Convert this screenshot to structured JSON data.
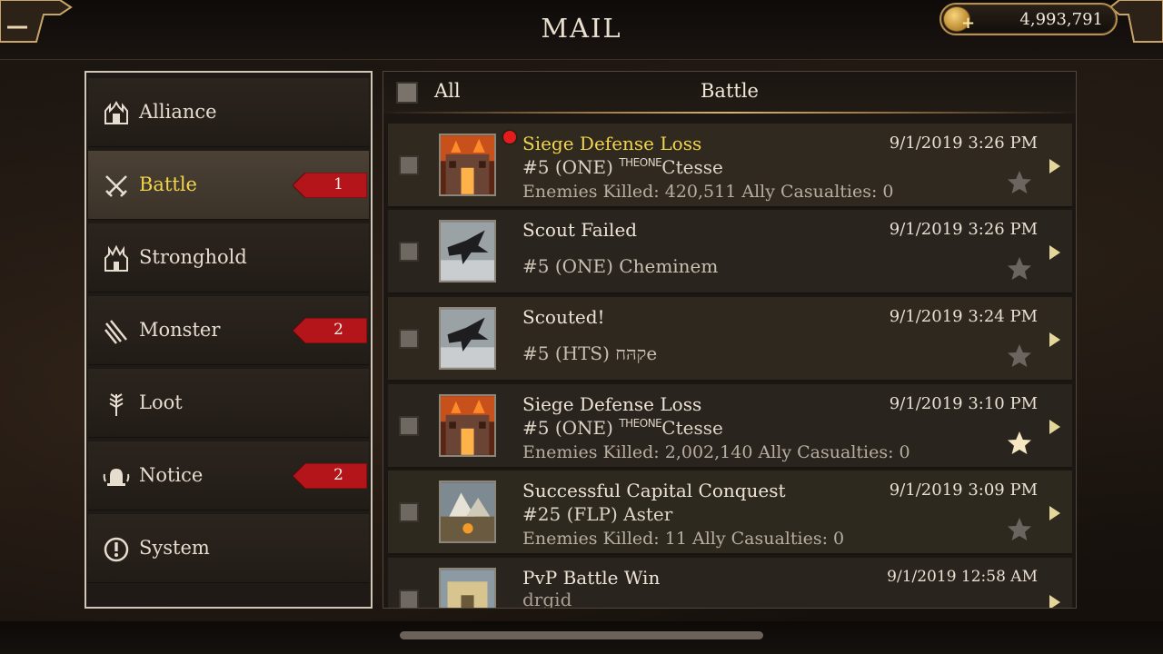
{
  "header": {
    "title": "MAIL",
    "gold": "4,993,791"
  },
  "sidebar": {
    "items": [
      {
        "label": "Alliance",
        "icon": "alliance-icon",
        "badge": ""
      },
      {
        "label": "Battle",
        "icon": "crossed-swords-icon",
        "badge": "1",
        "active": true
      },
      {
        "label": "Stronghold",
        "icon": "stronghold-icon",
        "badge": ""
      },
      {
        "label": "Monster",
        "icon": "claw-icon",
        "badge": "2"
      },
      {
        "label": "Loot",
        "icon": "wheat-icon",
        "badge": ""
      },
      {
        "label": "Notice",
        "icon": "bell-icon",
        "badge": "2"
      },
      {
        "label": "System",
        "icon": "exclamation-icon",
        "badge": ""
      }
    ]
  },
  "list": {
    "all_label": "All",
    "tab_title": "Battle",
    "rows": [
      {
        "title": "Siege Defense Loss",
        "unread": true,
        "player_prefix": "#5 (ONE) ",
        "player_tag": "THEONE",
        "player_name": "Ctesse",
        "extra": "Enemies Killed: 420,511 Ally Casualties: 0",
        "time": "9/1/2019 3:26 PM",
        "starred": false,
        "thumb": "burning-castle"
      },
      {
        "title": "Scout Failed",
        "unread": false,
        "player": "#5  (ONE) Cheminem",
        "time": "9/1/2019 3:26 PM",
        "starred": false,
        "thumb": "raven"
      },
      {
        "title": "Scouted!",
        "unread": false,
        "player": "#5 (HTS) קהּחe",
        "time": "9/1/2019 3:24 PM",
        "starred": false,
        "thumb": "raven"
      },
      {
        "title": "Siege Defense Loss",
        "unread": false,
        "player_prefix": "#5 (ONE) ",
        "player_tag": "THEONE",
        "player_name": "Ctesse",
        "extra": "Enemies Killed: 2,002,140 Ally Casualties: 0",
        "time": "9/1/2019 3:10 PM",
        "starred": true,
        "thumb": "burning-castle"
      },
      {
        "title": "Successful Capital Conquest",
        "unread": false,
        "player": "#25 (FLP) Aster",
        "extra": "Enemies Killed: 11 Ally Casualties: 0",
        "time": "9/1/2019 3:09 PM",
        "starred": false,
        "thumb": "capital-camp"
      },
      {
        "title": "PvP Battle Win",
        "unread": false,
        "player": "drgid",
        "time": "9/1/2019 12:58 AM",
        "starred": false,
        "thumb": "castle-gate"
      }
    ]
  },
  "colors": {
    "unread_title": "#f3d54b",
    "badge_red": "#b4151a",
    "star_active": "#f4e7c2",
    "star_inactive": "#6a6560"
  }
}
